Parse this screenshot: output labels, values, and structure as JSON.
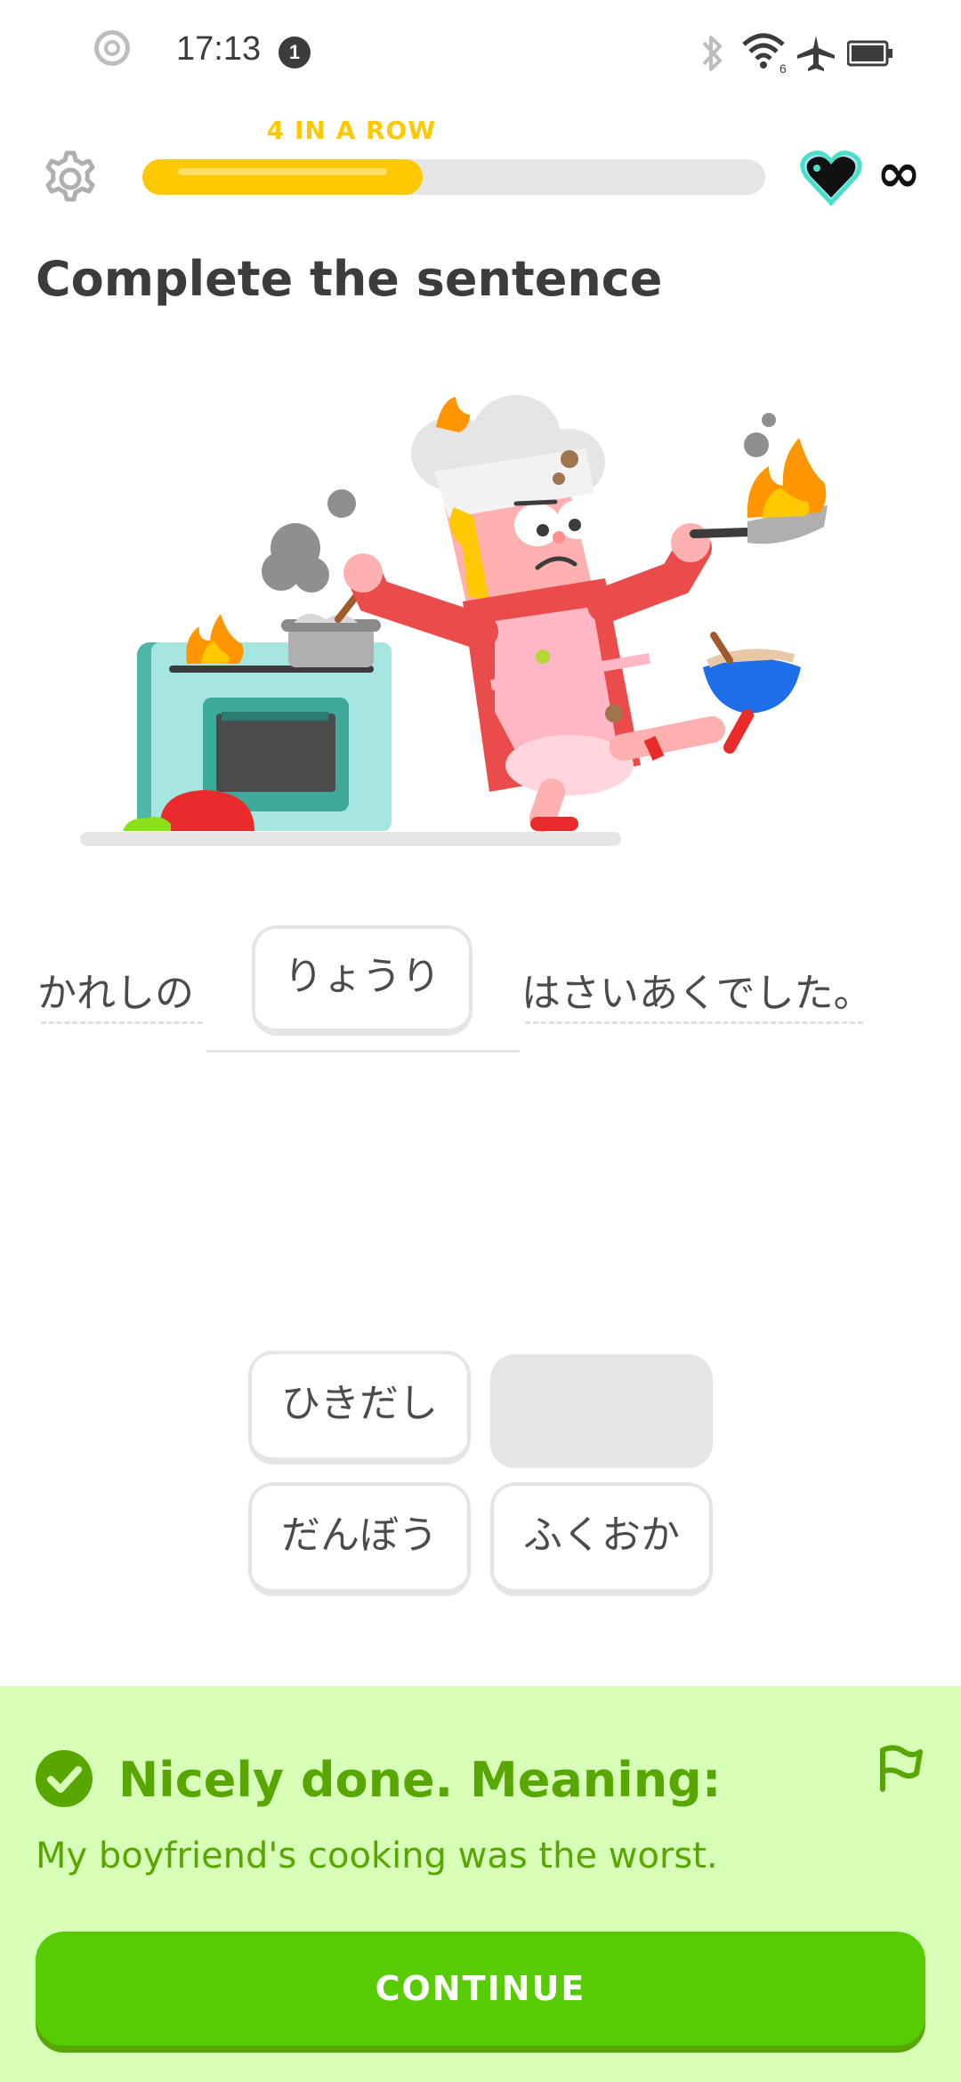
{
  "status_bar": {
    "time": "17:13",
    "notification_count": "1",
    "icons": [
      "circle-icon",
      "bluetooth-icon",
      "wifi-icon",
      "airplane-icon",
      "battery-icon"
    ]
  },
  "header": {
    "streak_label": "4 IN A ROW",
    "progress_fraction": 0.45,
    "hearts": "∞"
  },
  "prompt": {
    "title": "Complete the sentence"
  },
  "sentence": {
    "before": "かれしの",
    "answer": "りょうり",
    "after": "はさいあくでした。"
  },
  "word_bank": [
    {
      "label": "ひきだし",
      "used": false
    },
    {
      "label": "",
      "used": true
    },
    {
      "label": "だんぼう",
      "used": false
    },
    {
      "label": "ふくおか",
      "used": false
    }
  ],
  "feedback": {
    "title": "Nicely done. Meaning:",
    "meaning": "My boyfriend's cooking was the worst.",
    "button_label": "CONTINUE"
  },
  "colors": {
    "accent_yellow": "#ffc800",
    "success_green": "#58cc02",
    "success_dark": "#58a700",
    "success_bg": "#d7ffb8"
  }
}
